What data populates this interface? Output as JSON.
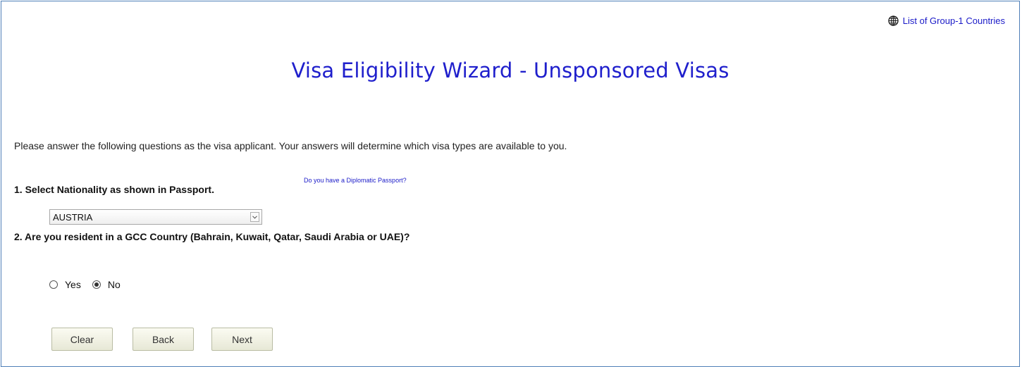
{
  "header": {
    "group_link_icon": "globe-icon",
    "group_link_label": "List of Group-1 Countries",
    "title": "Visa Eligibility Wizard - Unsponsored Visas"
  },
  "form": {
    "intro": "Please answer the following questions as the visa applicant. Your answers will determine which visa types are available to you.",
    "q1_label": "1. Select Nationality as shown in Passport.",
    "diplomatic_link": "Do you have a Diplomatic Passport?",
    "nationality_selected": "AUSTRIA",
    "q2_label": "2. Are you resident in a GCC Country (Bahrain, Kuwait, Qatar, Saudi Arabia or UAE)?",
    "radio_yes": "Yes",
    "radio_no": "No",
    "gcc_resident_selected": "No"
  },
  "buttons": {
    "clear": "Clear",
    "back": "Back",
    "next": "Next"
  },
  "colors": {
    "title": "#1f1fcc",
    "link": "#1a1ac8",
    "border": "#4f7fb8"
  }
}
